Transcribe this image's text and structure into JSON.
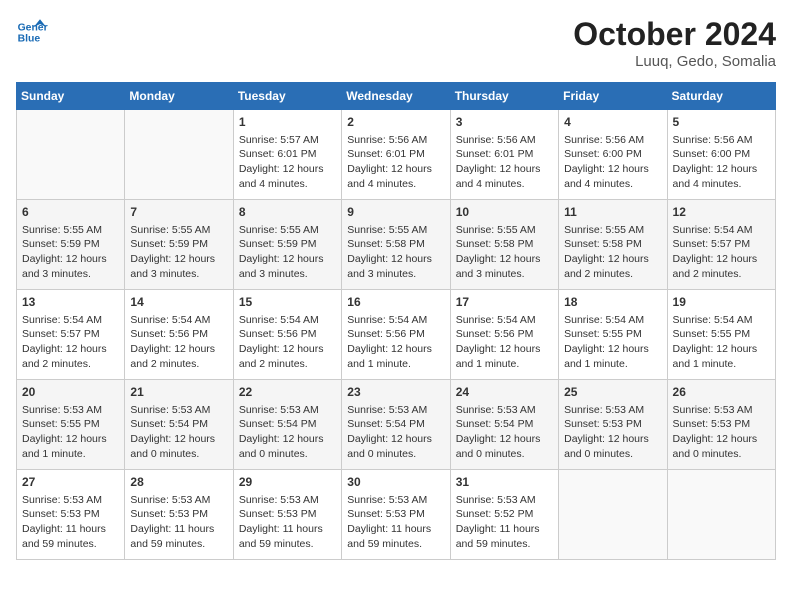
{
  "header": {
    "logo_line1": "General",
    "logo_line2": "Blue",
    "month": "October 2024",
    "location": "Luuq, Gedo, Somalia"
  },
  "days_of_week": [
    "Sunday",
    "Monday",
    "Tuesday",
    "Wednesday",
    "Thursday",
    "Friday",
    "Saturday"
  ],
  "weeks": [
    [
      {
        "day": "",
        "empty": true
      },
      {
        "day": "",
        "empty": true
      },
      {
        "day": "1",
        "sunrise": "Sunrise: 5:57 AM",
        "sunset": "Sunset: 6:01 PM",
        "daylight": "Daylight: 12 hours and 4 minutes."
      },
      {
        "day": "2",
        "sunrise": "Sunrise: 5:56 AM",
        "sunset": "Sunset: 6:01 PM",
        "daylight": "Daylight: 12 hours and 4 minutes."
      },
      {
        "day": "3",
        "sunrise": "Sunrise: 5:56 AM",
        "sunset": "Sunset: 6:01 PM",
        "daylight": "Daylight: 12 hours and 4 minutes."
      },
      {
        "day": "4",
        "sunrise": "Sunrise: 5:56 AM",
        "sunset": "Sunset: 6:00 PM",
        "daylight": "Daylight: 12 hours and 4 minutes."
      },
      {
        "day": "5",
        "sunrise": "Sunrise: 5:56 AM",
        "sunset": "Sunset: 6:00 PM",
        "daylight": "Daylight: 12 hours and 4 minutes."
      }
    ],
    [
      {
        "day": "6",
        "sunrise": "Sunrise: 5:55 AM",
        "sunset": "Sunset: 5:59 PM",
        "daylight": "Daylight: 12 hours and 3 minutes."
      },
      {
        "day": "7",
        "sunrise": "Sunrise: 5:55 AM",
        "sunset": "Sunset: 5:59 PM",
        "daylight": "Daylight: 12 hours and 3 minutes."
      },
      {
        "day": "8",
        "sunrise": "Sunrise: 5:55 AM",
        "sunset": "Sunset: 5:59 PM",
        "daylight": "Daylight: 12 hours and 3 minutes."
      },
      {
        "day": "9",
        "sunrise": "Sunrise: 5:55 AM",
        "sunset": "Sunset: 5:58 PM",
        "daylight": "Daylight: 12 hours and 3 minutes."
      },
      {
        "day": "10",
        "sunrise": "Sunrise: 5:55 AM",
        "sunset": "Sunset: 5:58 PM",
        "daylight": "Daylight: 12 hours and 3 minutes."
      },
      {
        "day": "11",
        "sunrise": "Sunrise: 5:55 AM",
        "sunset": "Sunset: 5:58 PM",
        "daylight": "Daylight: 12 hours and 2 minutes."
      },
      {
        "day": "12",
        "sunrise": "Sunrise: 5:54 AM",
        "sunset": "Sunset: 5:57 PM",
        "daylight": "Daylight: 12 hours and 2 minutes."
      }
    ],
    [
      {
        "day": "13",
        "sunrise": "Sunrise: 5:54 AM",
        "sunset": "Sunset: 5:57 PM",
        "daylight": "Daylight: 12 hours and 2 minutes."
      },
      {
        "day": "14",
        "sunrise": "Sunrise: 5:54 AM",
        "sunset": "Sunset: 5:56 PM",
        "daylight": "Daylight: 12 hours and 2 minutes."
      },
      {
        "day": "15",
        "sunrise": "Sunrise: 5:54 AM",
        "sunset": "Sunset: 5:56 PM",
        "daylight": "Daylight: 12 hours and 2 minutes."
      },
      {
        "day": "16",
        "sunrise": "Sunrise: 5:54 AM",
        "sunset": "Sunset: 5:56 PM",
        "daylight": "Daylight: 12 hours and 1 minute."
      },
      {
        "day": "17",
        "sunrise": "Sunrise: 5:54 AM",
        "sunset": "Sunset: 5:56 PM",
        "daylight": "Daylight: 12 hours and 1 minute."
      },
      {
        "day": "18",
        "sunrise": "Sunrise: 5:54 AM",
        "sunset": "Sunset: 5:55 PM",
        "daylight": "Daylight: 12 hours and 1 minute."
      },
      {
        "day": "19",
        "sunrise": "Sunrise: 5:54 AM",
        "sunset": "Sunset: 5:55 PM",
        "daylight": "Daylight: 12 hours and 1 minute."
      }
    ],
    [
      {
        "day": "20",
        "sunrise": "Sunrise: 5:53 AM",
        "sunset": "Sunset: 5:55 PM",
        "daylight": "Daylight: 12 hours and 1 minute."
      },
      {
        "day": "21",
        "sunrise": "Sunrise: 5:53 AM",
        "sunset": "Sunset: 5:54 PM",
        "daylight": "Daylight: 12 hours and 0 minutes."
      },
      {
        "day": "22",
        "sunrise": "Sunrise: 5:53 AM",
        "sunset": "Sunset: 5:54 PM",
        "daylight": "Daylight: 12 hours and 0 minutes."
      },
      {
        "day": "23",
        "sunrise": "Sunrise: 5:53 AM",
        "sunset": "Sunset: 5:54 PM",
        "daylight": "Daylight: 12 hours and 0 minutes."
      },
      {
        "day": "24",
        "sunrise": "Sunrise: 5:53 AM",
        "sunset": "Sunset: 5:54 PM",
        "daylight": "Daylight: 12 hours and 0 minutes."
      },
      {
        "day": "25",
        "sunrise": "Sunrise: 5:53 AM",
        "sunset": "Sunset: 5:53 PM",
        "daylight": "Daylight: 12 hours and 0 minutes."
      },
      {
        "day": "26",
        "sunrise": "Sunrise: 5:53 AM",
        "sunset": "Sunset: 5:53 PM",
        "daylight": "Daylight: 12 hours and 0 minutes."
      }
    ],
    [
      {
        "day": "27",
        "sunrise": "Sunrise: 5:53 AM",
        "sunset": "Sunset: 5:53 PM",
        "daylight": "Daylight: 11 hours and 59 minutes."
      },
      {
        "day": "28",
        "sunrise": "Sunrise: 5:53 AM",
        "sunset": "Sunset: 5:53 PM",
        "daylight": "Daylight: 11 hours and 59 minutes."
      },
      {
        "day": "29",
        "sunrise": "Sunrise: 5:53 AM",
        "sunset": "Sunset: 5:53 PM",
        "daylight": "Daylight: 11 hours and 59 minutes."
      },
      {
        "day": "30",
        "sunrise": "Sunrise: 5:53 AM",
        "sunset": "Sunset: 5:53 PM",
        "daylight": "Daylight: 11 hours and 59 minutes."
      },
      {
        "day": "31",
        "sunrise": "Sunrise: 5:53 AM",
        "sunset": "Sunset: 5:52 PM",
        "daylight": "Daylight: 11 hours and 59 minutes."
      },
      {
        "day": "",
        "empty": true
      },
      {
        "day": "",
        "empty": true
      }
    ]
  ]
}
